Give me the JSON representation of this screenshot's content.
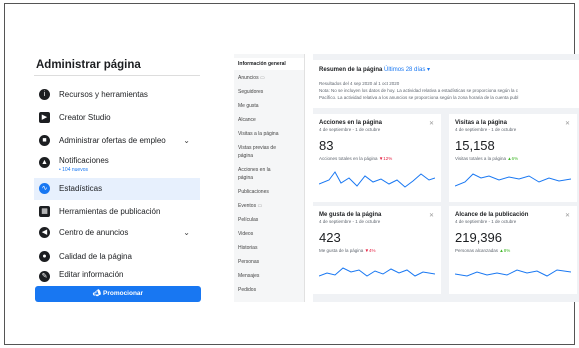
{
  "left_panel": {
    "title": "Administrar página",
    "items": [
      {
        "label": "Recursos y herramientas",
        "icon": "info-icon"
      },
      {
        "label": "Creator Studio",
        "icon": "video-icon"
      },
      {
        "label": "Administrar ofertas de empleo",
        "icon": "briefcase-icon"
      },
      {
        "label": "Notificaciones",
        "icon": "bell-icon",
        "sub": "• 104 nuevos"
      },
      {
        "label": "Estadísticas",
        "icon": "chart-icon"
      },
      {
        "label": "Herramientas de publicación",
        "icon": "calendar-icon"
      },
      {
        "label": "Centro de anuncios",
        "icon": "megaphone-icon"
      },
      {
        "label": "Calidad de la página",
        "icon": "shield-icon"
      },
      {
        "label": "Editar información",
        "icon": "edit-icon"
      }
    ],
    "promote_label": "Promocionar"
  },
  "insights_nav": {
    "items": [
      "Información general",
      "Anuncios",
      "Seguidores",
      "Me gusta",
      "Alcance",
      "Visitas a la página",
      "Vistas previas de",
      "página",
      "Acciones en la",
      "página",
      "Publicaciones",
      "Eventos",
      "Películas",
      "Videos",
      "Historias",
      "Personas",
      "Mensajes",
      "Pedidos"
    ]
  },
  "summary": {
    "title": "Resumen de la página",
    "range": "Últimos 28 días",
    "note_lines": [
      "Resultados del 4 sep 2020 al 1 oct 2020",
      "Nota: No se incluyen los datos de hoy. La actividad relativa a estadísticas se proporciona según la c",
      "Pacífico. La actividad relativa a los anuncios se proporciona según la zona horaria de la cuenta publ"
    ]
  },
  "cards": [
    {
      "title": "Acciones en la página",
      "date": "4 de septiembre - 1 de octubre",
      "value": "83",
      "caption": "Acciones totales en la página",
      "change": "▼12%",
      "dir": "down"
    },
    {
      "title": "Visitas a la página",
      "date": "4 de septiembre - 1 de octubre",
      "value": "15,158",
      "caption": "Visitas totales a la página",
      "change": "▲6%",
      "dir": "up"
    },
    {
      "title": "Me gusta de la página",
      "date": "4 de septiembre - 1 de octubre",
      "value": "423",
      "caption": "Me gusta de la página",
      "change": "▼4%",
      "dir": "down"
    },
    {
      "title": "Alcance de la publicación",
      "date": "4 de septiembre - 1 de octubre",
      "value": "219,396",
      "caption": "Personas alcanzadas",
      "change": "▲8%",
      "dir": "up"
    }
  ],
  "colors": {
    "accent": "#1877f2",
    "down": "#e41e3f",
    "up": "#42b72a"
  }
}
